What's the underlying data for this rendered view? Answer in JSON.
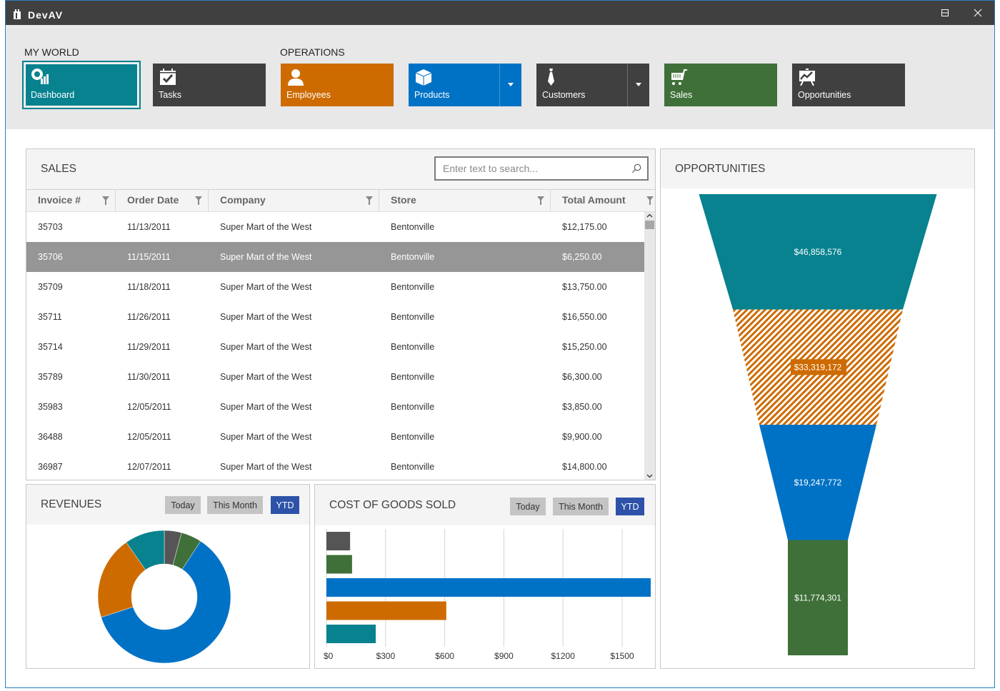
{
  "window": {
    "title": "DevAV",
    "controls": {
      "minimize": "minimize",
      "maximize": "maximize",
      "close": "close"
    }
  },
  "ribbon": {
    "groups": [
      {
        "label": "MY WORLD"
      },
      {
        "label": "OPERATIONS"
      }
    ],
    "tiles": [
      {
        "label": "Dashboard",
        "icon": "dashboard-icon",
        "color": "#08828f",
        "selected": true
      },
      {
        "label": "Tasks",
        "icon": "calendar-check-icon",
        "color": "#404040"
      },
      {
        "label": "Employees",
        "icon": "person-icon",
        "color": "#cd6b00"
      },
      {
        "label": "Products",
        "icon": "box-icon",
        "color": "#0072c6",
        "has_dropdown": true
      },
      {
        "label": "Customers",
        "icon": "tie-icon",
        "color": "#404040",
        "has_dropdown": true
      },
      {
        "label": "Sales",
        "icon": "cart-icon",
        "color": "#3f7039"
      },
      {
        "label": "Opportunities",
        "icon": "presentation-chart-icon",
        "color": "#404040"
      }
    ]
  },
  "sales": {
    "title": "SALES",
    "search": {
      "placeholder": "Enter text to search...",
      "value": ""
    },
    "columns": [
      "Invoice #",
      "Order Date",
      "Company",
      "Store",
      "Total Amount"
    ],
    "rows": [
      [
        "35703",
        "11/13/2011",
        "Super Mart of the West",
        "Bentonville",
        "$12,175.00"
      ],
      [
        "35706",
        "11/15/2011",
        "Super Mart of the West",
        "Bentonville",
        "$6,250.00"
      ],
      [
        "35709",
        "11/18/2011",
        "Super Mart of the West",
        "Bentonville",
        "$13,750.00"
      ],
      [
        "35711",
        "11/26/2011",
        "Super Mart of the West",
        "Bentonville",
        "$16,550.00"
      ],
      [
        "35714",
        "11/29/2011",
        "Super Mart of the West",
        "Bentonville",
        "$15,250.00"
      ],
      [
        "35789",
        "11/30/2011",
        "Super Mart of the West",
        "Bentonville",
        "$6,300.00"
      ],
      [
        "35983",
        "12/05/2011",
        "Super Mart of the West",
        "Bentonville",
        "$3,850.00"
      ],
      [
        "36488",
        "12/05/2011",
        "Super Mart of the West",
        "Bentonville",
        "$9,900.00"
      ],
      [
        "36987",
        "12/07/2011",
        "Super Mart of the West",
        "Bentonville",
        "$14,800.00"
      ]
    ],
    "selected_row": 1
  },
  "revenues": {
    "title": "REVENUES",
    "periods": [
      "Today",
      "This Month",
      "YTD"
    ],
    "active_period": "YTD"
  },
  "cogs": {
    "title": "COST OF GOODS SOLD",
    "periods": [
      "Today",
      "This Month",
      "YTD"
    ],
    "active_period": "YTD"
  },
  "opportunities": {
    "title": "OPPORTUNITIES"
  },
  "chart_data": [
    {
      "type": "pie",
      "variant": "donut",
      "title": "REVENUES",
      "slices": [
        {
          "value": 4.2,
          "color": "#555555"
        },
        {
          "value": 5.0,
          "color": "#3f7039"
        },
        {
          "value": 60.8,
          "color": "#0072c6"
        },
        {
          "value": 20.3,
          "color": "#cd6b00"
        },
        {
          "value": 9.7,
          "color": "#08828f"
        }
      ],
      "start_angle_deg": 0,
      "direction": "clockwise"
    },
    {
      "type": "bar",
      "orientation": "horizontal",
      "title": "COST OF GOODS SOLD",
      "values": [
        120,
        130,
        1645,
        608,
        250
      ],
      "colors": [
        "#555555",
        "#3f7039",
        "#0072c6",
        "#cd6b00",
        "#08828f"
      ],
      "xlim": [
        0,
        1650
      ],
      "x_ticks": [
        0,
        300,
        600,
        900,
        1200,
        1500
      ],
      "x_tick_labels": [
        "$0",
        "$300",
        "$600",
        "$900",
        "$1200",
        "$1500"
      ],
      "grid": true
    },
    {
      "type": "bar",
      "variant": "funnel",
      "title": "OPPORTUNITIES",
      "values": [
        46858576,
        33319172,
        19247772,
        11774301
      ],
      "labels": [
        "$46,858,576",
        "$33,319,172",
        "$19,247,772",
        "$11,774,301"
      ],
      "colors": [
        "#08828f",
        "#cd6b00",
        "#0072c6",
        "#3f7039"
      ],
      "highlighted_index": 1
    }
  ]
}
